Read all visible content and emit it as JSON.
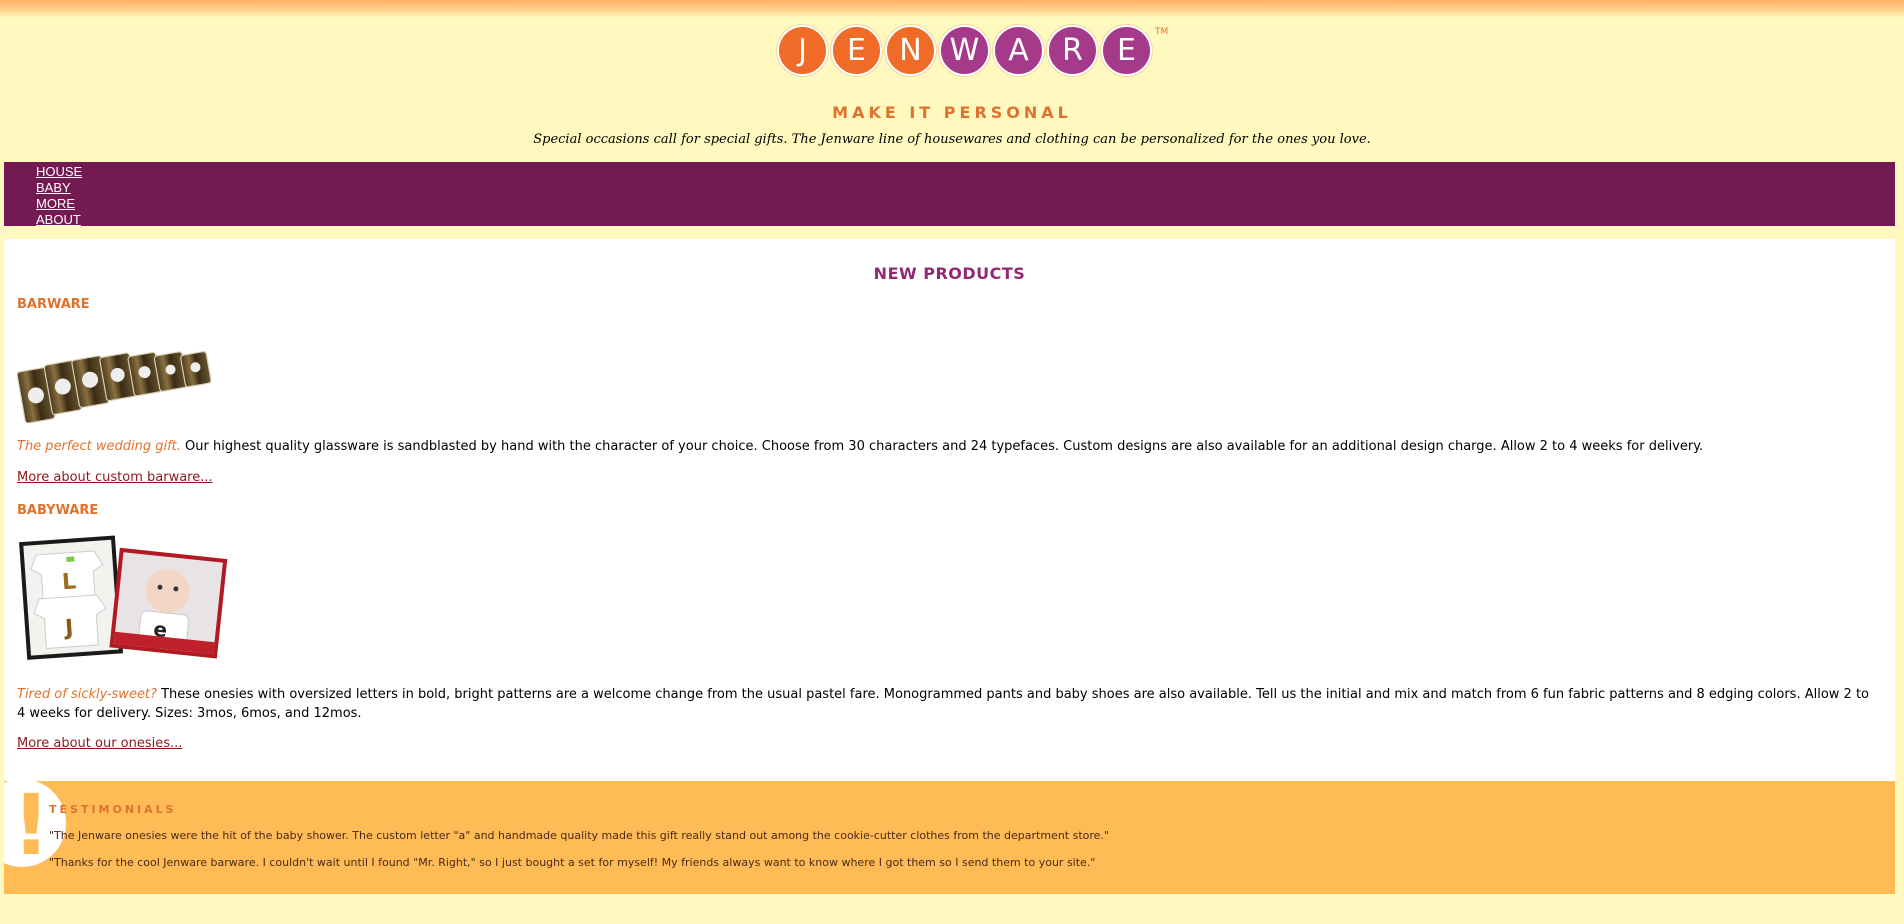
{
  "brand": {
    "logo_letters": [
      "J",
      "E",
      "N",
      "W",
      "A",
      "R",
      "E"
    ],
    "logo_colors": [
      "#f06a28",
      "#f06a28",
      "#f06a28",
      "#a63a8a",
      "#a63a8a",
      "#a63a8a",
      "#a63a8a"
    ],
    "trademark": "TM",
    "slogan": "MAKE IT PERSONAL",
    "tagline": "Special occasions call for special gifts. The Jenware line of housewares and clothing can be personalized for the ones you love."
  },
  "nav": {
    "items": [
      {
        "label": "HOUSE"
      },
      {
        "label": "BABY"
      },
      {
        "label": "MORE"
      },
      {
        "label": "ABOUT"
      }
    ]
  },
  "main": {
    "title": "NEW PRODUCTS",
    "sections": [
      {
        "heading": "BARWARE",
        "lead": "The perfect wedding gift.",
        "body": " Our highest quality glassware is sandblasted by hand with the character of your choice. Choose from 30 characters and 24 typefaces. Custom designs are also available for an additional design charge. Allow 2 to 4 weeks for delivery.",
        "link": "More about custom barware..."
      },
      {
        "heading": "BABYWARE",
        "lead": "Tired of sickly-sweet?",
        "body": " These onesies with oversized letters in bold, bright patterns are a welcome change from the usual pastel fare. Monogrammed pants and baby shoes are also available. Tell us the initial and mix and match from 6 fun fabric patterns and 8 edging colors. Allow 2 to 4 weeks for delivery. Sizes: 3mos, 6mos, and 12mos.",
        "link": "More about our onesies..."
      }
    ]
  },
  "testimonials": {
    "heading": "TESTIMONIALS",
    "quotes": [
      "\"The Jenware onesies were the hit of the baby shower. The custom letter \"a\" and handmade quality made this gift really stand out among the cookie-cutter clothes from the department store.\"",
      "\"Thanks for the cool Jenware barware. I couldn't wait until I found \"Mr. Right,\" so I just bought a set for myself! My friends always want to know where I got them so I send them to your site.\""
    ]
  },
  "colors": {
    "page_bg": "#fff9bf",
    "nav_bg": "#731a52",
    "accent_orange": "#e0722f",
    "title_purple": "#8f2a73",
    "testimonial_bg": "#ffbb55",
    "link": "#8b1a1a"
  }
}
